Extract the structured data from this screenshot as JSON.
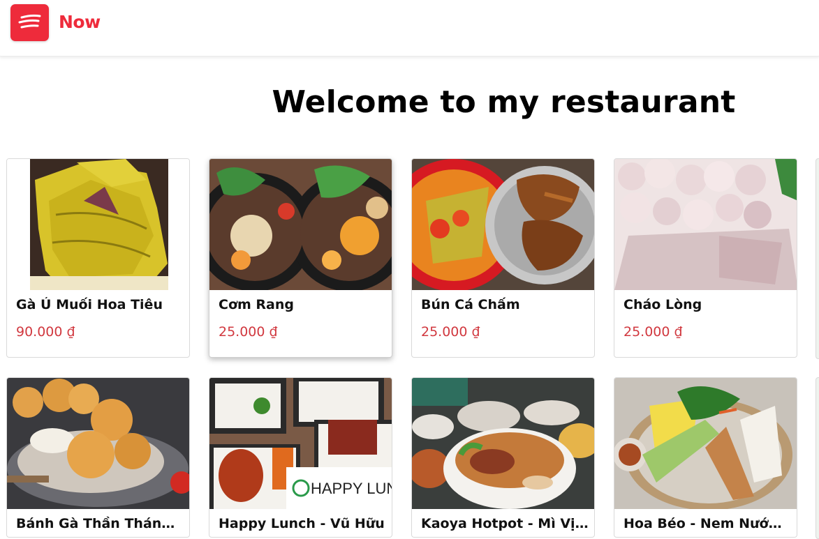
{
  "app": {
    "brand": "Now"
  },
  "page": {
    "title": "Welcome to my restaurant"
  },
  "items": [
    {
      "name": "Gà Ủ Muối Hoa Tiêu",
      "price": "90.000 ₫",
      "image": "chicken-photo"
    },
    {
      "name": "Cơm Rang",
      "price": "25.000 ₫",
      "image": "fried-rice-photo"
    },
    {
      "name": "Bún Cá Chấm",
      "price": "25.000 ₫",
      "image": "fish-noodle-photo"
    },
    {
      "name": "Cháo Lòng",
      "price": "25.000 ₫",
      "image": "pork-offal-photo"
    },
    {
      "name": "Bánh Gà Thần Thánh - Nguyễn Văn Cừ",
      "image": "chicken-cake-photo"
    },
    {
      "name": "Happy Lunch - Vũ Hữu",
      "image": "lunch-box-photo",
      "image_text": "HAPPY LUNCH"
    },
    {
      "name": "Kaoya Hotpot - Mì Vịt Quay",
      "image": "duck-noodle-photo"
    },
    {
      "name": "Hoa Béo - Nem Nướng Nha Trang",
      "image": "spring-roll-photo"
    }
  ],
  "colors": {
    "brand": "#ee2b3b",
    "price": "#d1383f"
  }
}
